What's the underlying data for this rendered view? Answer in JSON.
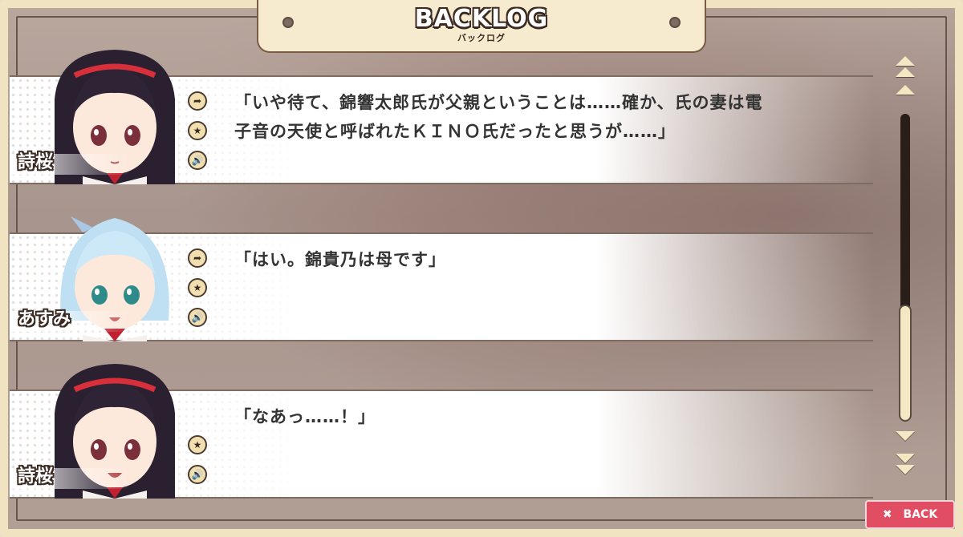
{
  "header": {
    "title": "BACKLOG",
    "subtitle": "バックログ"
  },
  "entries": [
    {
      "speaker": "詩桜",
      "text": "「いや待て、錦響太郎氏が父親ということは……確か、氏の妻は電子音の天使と呼ばれたＫＩＮＯ氏だったと思うが……」",
      "buttons": [
        "jump-icon",
        "star-icon",
        "voice-icon"
      ]
    },
    {
      "speaker": "あすみ",
      "text": "「はい。錦貴乃は母です」",
      "buttons": [
        "jump-icon",
        "star-icon",
        "voice-icon"
      ]
    },
    {
      "speaker": "詩桜",
      "text": "「なあっ……！」",
      "buttons": [
        "star-icon",
        "voice-icon"
      ]
    }
  ],
  "scrollbar": {
    "position_fraction": 1.0
  },
  "back_button": {
    "label": "BACK",
    "icon": "close-icon"
  },
  "colors": {
    "frame": "#efe3c2",
    "accent_back": "#e14d62",
    "text": "#333333"
  }
}
